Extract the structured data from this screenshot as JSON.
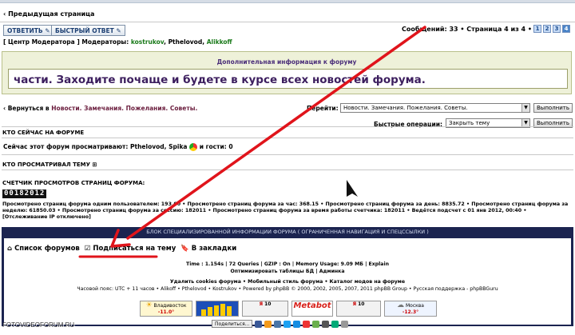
{
  "top": {
    "prev_page": "Предыдущая страница",
    "reply_button": "ОТВЕТИТЬ",
    "quick_reply_button": "БЫСТРЫЙ ОТВЕТ",
    "pagination_text": "Сообщений: 33 • Страница 4 из 4 •",
    "pages": [
      "1",
      "2",
      "3",
      "4"
    ],
    "current_page": "4"
  },
  "moderators": {
    "prefix": "[ Центр Модератора ]",
    "label": "Модераторы:",
    "names": [
      "kostrukov",
      "Pthelovod",
      "Alikkoff"
    ]
  },
  "info_box": {
    "heading": "Дополнительная информация к форуму",
    "text": "части. Заходите почаще и будете в курсе всех новостей форума."
  },
  "nav": {
    "back_prefix": "Вернуться в",
    "back_link": "Новости. Замечания. Пожелания. Советы.",
    "jump_label": "Перейти:",
    "jump_value": "Новости. Замечания. Пожелания. Советы.",
    "go_button": "Выполнить",
    "quick_ops_label": "Быстрые операции:",
    "quick_ops_value": "Закрыть тему",
    "go_button2": "Выполнить"
  },
  "who_online": {
    "heading": "КТО СЕЙЧАС НА ФОРУМЕ",
    "text_prefix": "Сейчас этот форум просматривают:",
    "users": "Pthelovod, Spika",
    "text_suffix": "и гости: 0"
  },
  "viewed": {
    "heading": "КТО ПРОСМАТРИВАЛ ТЕМУ"
  },
  "counter": {
    "heading": "СЧЕТЧИК ПРОСМОТРОВ СТРАНИЦ ФОРУМА:",
    "value": "00182012",
    "stats_line1": "Просмотрено страниц форума одним пользователем: 193.00 • Просмотрено страниц форума за час: 368.15 • Просмотрено страниц форума за день: 8835.72 • Просмотрено страниц форума за",
    "stats_line2": "неделю: 61850.03 • Просмотрено страниц форума за сессию: 182011 • Просмотрено страниц форума за время работы счетчика: 182011 • Ведётся подсчет с 01 янв 2012, 00:40 •",
    "stats_line3": "[Отслеживание IP отключено]"
  },
  "footer_panel": {
    "heading": "БЛОК СПЕЦИАЛИЗИРОВАННОЙ ИНФОРМАЦИИ ФОРУМА ( ОГРАНИЧЕННАЯ НАВИГАЦИЯ И СПЕЦССЫЛКИ )",
    "forum_list": "Список форумов",
    "subscribe": "Подписаться на тему",
    "bookmarks": "В закладки",
    "debug_line": "Time : 1.154s | 72 Queries | GZIP : On | Memory Usage: 9.09 MБ | Explain",
    "optimize_line": "Оптимизировать таблицы БД | Админка",
    "cookies_line": "Удалить cookies форума • Мобильный стиль форума • Каталог модов на форуме",
    "timezone_line": "Часовой пояс: UTC + 11 часов • Alikoff • Pthelovod • Kostrukov • Powered by phpBB © 2000, 2002, 2005, 2007, 2011 phpBB Group • Русская поддержка - phpBBGuru",
    "weather1": "Владивосток",
    "weather1_temp": "-11.0°",
    "weather2": "Москва",
    "weather2_temp": "-12.3°",
    "metabot": "Metabot",
    "share_button": "Поделиться..."
  },
  "watermark": "FOTOVIDEOFORUM.RU",
  "colors": {
    "panel_dark": "#1b2450",
    "info_bg": "#eef1d9",
    "arrow_red": "#e0141b",
    "moderator_green": "#1a7a1a"
  }
}
